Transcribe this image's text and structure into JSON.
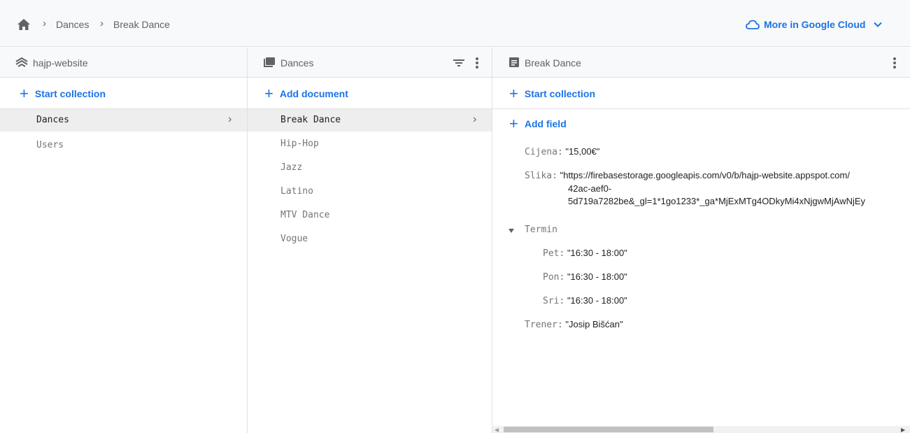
{
  "breadcrumb": [
    "Dances",
    "Break Dance"
  ],
  "cloud_link": "More in Google Cloud",
  "columns": {
    "root": {
      "title": "hajp-website",
      "action": "Start collection",
      "items": [
        {
          "label": "Dances",
          "selected": true
        },
        {
          "label": "Users",
          "selected": false
        }
      ]
    },
    "collection": {
      "title": "Dances",
      "action": "Add document",
      "items": [
        {
          "label": "Break Dance",
          "selected": true
        },
        {
          "label": "Hip-Hop",
          "selected": false
        },
        {
          "label": "Jazz",
          "selected": false
        },
        {
          "label": "Latino",
          "selected": false
        },
        {
          "label": "MTV Dance",
          "selected": false
        },
        {
          "label": "Vogue",
          "selected": false
        }
      ]
    },
    "document": {
      "title": "Break Dance",
      "action_collection": "Start collection",
      "action_field": "Add field",
      "fields": {
        "cijena": {
          "key": "Cijena:",
          "value": "\"15,00€\""
        },
        "slika": {
          "key": "Slika:",
          "value_lines": [
            "\"https://firebasestorage.googleapis.com/v0/b/hajp-website.appspot.com/",
            "42ac-aef0-",
            "5d719a7282be&_gl=1*1go1233*_ga*MjExMTg4ODkyMi4xNjgwMjAwNjEy"
          ]
        },
        "termin": {
          "key": "Termin",
          "children": [
            {
              "key": "Pet:",
              "value": "\"16:30 - 18:00\""
            },
            {
              "key": "Pon:",
              "value": "\"16:30 - 18:00\""
            },
            {
              "key": "Sri:",
              "value": "\"16:30 - 18:00\""
            }
          ]
        },
        "trener": {
          "key": "Trener:",
          "value": "\"Josip Bišćan\""
        }
      }
    }
  },
  "colors": {
    "accent": "#1a73e8",
    "header_bg": "#f8f9fa",
    "selected_row": "#eeeeee",
    "border": "#e0e0e0"
  },
  "icons": {
    "home": "home-icon",
    "project": "firestore-icon",
    "collection": "collection-icon",
    "document": "document-icon",
    "filter": "filter-icon",
    "more": "more-vert-icon",
    "cloud": "cloud-icon",
    "expand": "chevron-down-icon",
    "arrow": "chevron-right-icon"
  }
}
